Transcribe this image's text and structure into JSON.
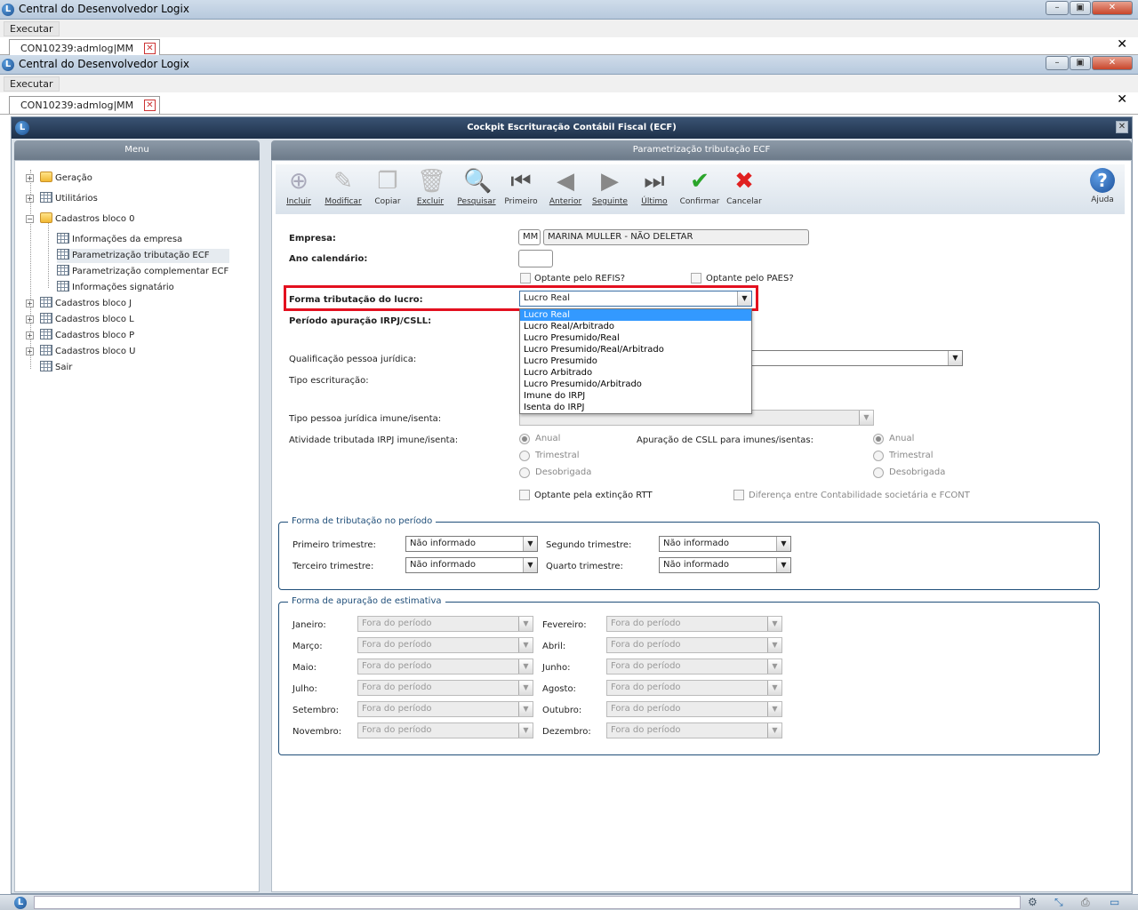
{
  "outer_window": {
    "title": "Central do Desenvolvedor Logix",
    "menu": "Executar",
    "tab": "CON10239:admlog|MM"
  },
  "inner_window": {
    "title": "Central do Desenvolvedor Logix",
    "menu": "Executar",
    "tab": "CON10239:admlog|MM"
  },
  "frame": {
    "title": "Cockpit Escrituração Contábil Fiscal (ECF)"
  },
  "menu_panel": {
    "title": "Menu",
    "items": [
      {
        "label": "Geração"
      },
      {
        "label": "Utilitários"
      },
      {
        "label": "Cadastros bloco 0"
      },
      {
        "label": "Informações da empresa"
      },
      {
        "label": "Parametrização tributação ECF"
      },
      {
        "label": "Parametrização complementar ECF"
      },
      {
        "label": "Informações signatário"
      },
      {
        "label": "Cadastros bloco J"
      },
      {
        "label": "Cadastros bloco L"
      },
      {
        "label": "Cadastros bloco P"
      },
      {
        "label": "Cadastros bloco U"
      },
      {
        "label": "Sair"
      }
    ]
  },
  "content": {
    "title": "Parametrização tributação ECF"
  },
  "toolbar": {
    "buttons": [
      {
        "label": "Incluir",
        "icon": "add-icon"
      },
      {
        "label": "Modificar",
        "icon": "edit-icon"
      },
      {
        "label": "Copiar",
        "icon": "copy-icon"
      },
      {
        "label": "Excluir",
        "icon": "trash-icon"
      },
      {
        "label": "Pesquisar",
        "icon": "search-icon"
      },
      {
        "label": "Primeiro",
        "icon": "first-icon"
      },
      {
        "label": "Anterior",
        "icon": "previous-icon"
      },
      {
        "label": "Seguinte",
        "icon": "next-icon"
      },
      {
        "label": "Último",
        "icon": "last-icon"
      },
      {
        "label": "Confirmar",
        "icon": "check-icon"
      },
      {
        "label": "Cancelar",
        "icon": "cancel-icon"
      }
    ],
    "help": "Ajuda"
  },
  "form": {
    "empresa_label": "Empresa:",
    "empresa_code": "MM",
    "empresa_name": "MARINA MULLER - NÃO DELETAR",
    "ano_label": "Ano calendário:",
    "refis_label": "Optante pelo REFIS?",
    "paes_label": "Optante pelo PAES?",
    "forma_label": "Forma tributação do lucro:",
    "forma_value": "Lucro Real",
    "periodo_label": "Período apuração IRPJ/CSLL:",
    "qualificacao_label": "Qualificação pessoa jurídica:",
    "tipo_escrit_label": "Tipo escrituração:",
    "tipo_pessoa_label": "Tipo pessoa jurídica imune/isenta:",
    "atividade_label": "Atividade tributada IRPJ imune/isenta:",
    "csll_label": "Apuração de CSLL para imunes/isentas:",
    "radio_anual": "Anual",
    "radio_trimestral": "Trimestral",
    "radio_desobrigada": "Desobrigada",
    "rtt_label": "Optante pela extinção RTT",
    "fcont_label": "Diferença entre Contabilidade societária e FCONT"
  },
  "dropdown_options": [
    "Lucro Real",
    "Lucro Real/Arbitrado",
    "Lucro Presumido/Real",
    "Lucro Presumido/Real/Arbitrado",
    "Lucro Presumido",
    "Lucro Arbitrado",
    "Lucro Presumido/Arbitrado",
    "Imune do IRPJ",
    "Isenta do IRPJ"
  ],
  "periodo_group": {
    "title": "Forma de tributação no período",
    "primeiro": "Primeiro trimestre:",
    "segundo": "Segundo trimestre:",
    "terceiro": "Terceiro trimestre:",
    "quarto": "Quarto trimestre:",
    "value": "Não informado"
  },
  "estimativa_group": {
    "title": "Forma de apuração de estimativa",
    "value": "Fora do período",
    "months": [
      "Janeiro:",
      "Fevereiro:",
      "Março:",
      "Abril:",
      "Maio:",
      "Junho:",
      "Julho:",
      "Agosto:",
      "Setembro:",
      "Outubro:",
      "Novembro:",
      "Dezembro:"
    ]
  }
}
